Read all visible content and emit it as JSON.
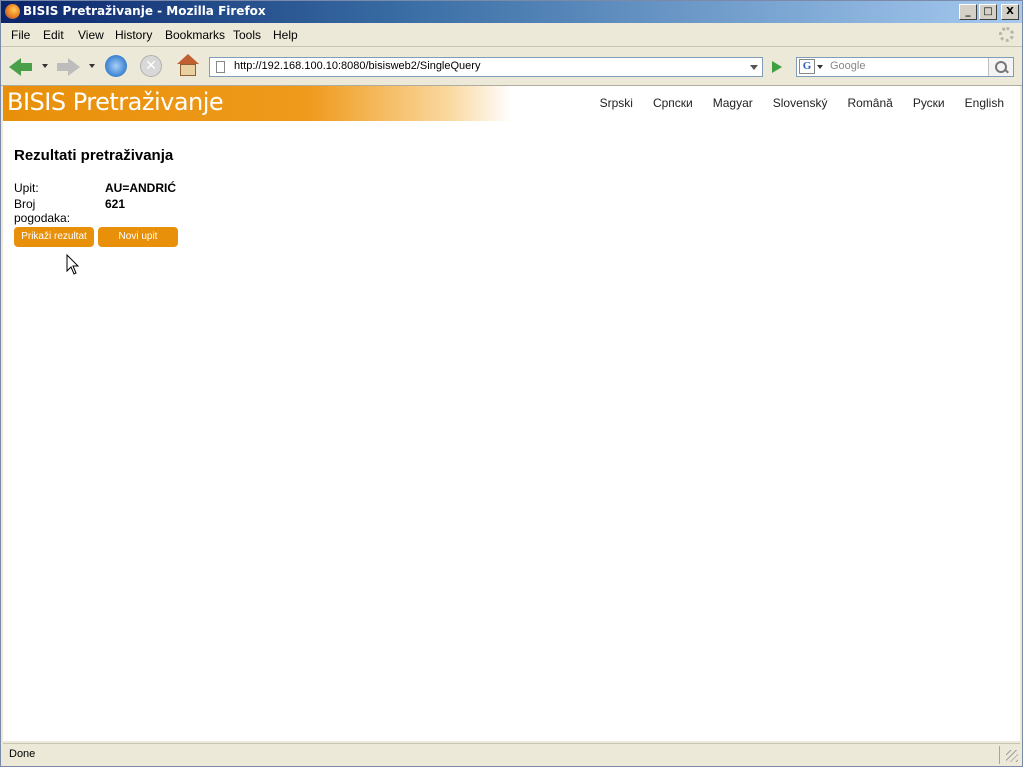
{
  "window": {
    "title": "BISIS Pretraživanje - Mozilla Firefox",
    "min": "_",
    "max": "□",
    "close": "X"
  },
  "menu": [
    "File",
    "Edit",
    "View",
    "History",
    "Bookmarks",
    "Tools",
    "Help"
  ],
  "navbar": {
    "url": "http://192.168.100.10:8080/bisisweb2/SingleQuery",
    "search_placeholder": "Google",
    "search_engine_glyph": "G"
  },
  "page": {
    "brand": "BISIS Pretraživanje",
    "languages": [
      "Srpski",
      "Српски",
      "Magyar",
      "Slovenský",
      "Română",
      "Руски",
      "English"
    ],
    "heading": "Rezultati pretraživanja",
    "query_label": "Upit:",
    "query_value": "AU=ANDRIĆ",
    "hits_label": "Broj pogodaka:",
    "hits_value": "621",
    "show_results_button": "Prikaži rezultat",
    "new_query_button": "Novi upit",
    "brand_color": "#e8900a"
  },
  "status": {
    "text": "Done"
  }
}
